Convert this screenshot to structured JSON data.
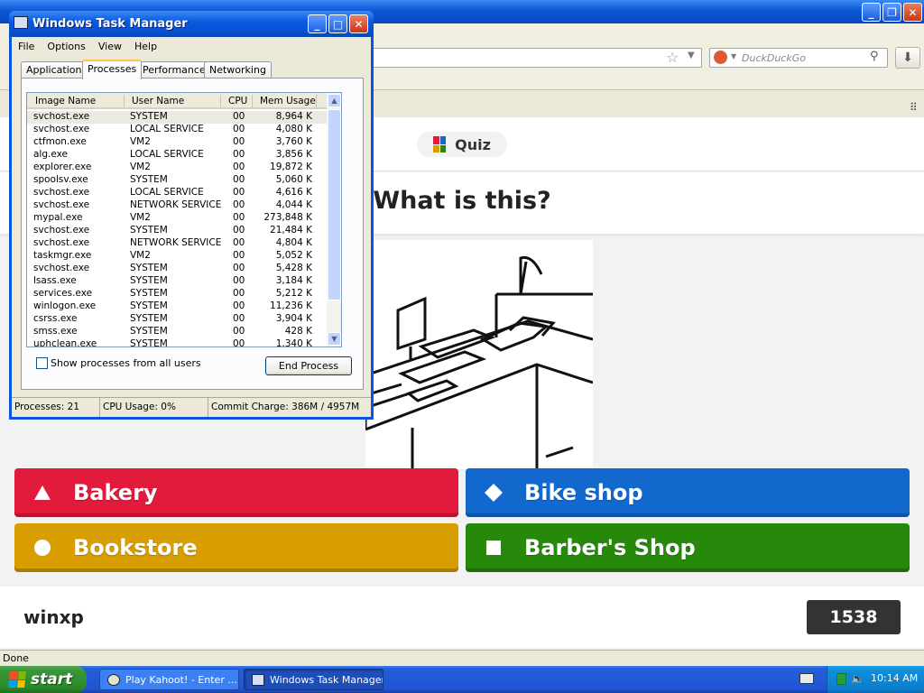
{
  "browser": {
    "search_placeholder": "DuckDuckGo"
  },
  "quiz": {
    "pill_label": "Quiz",
    "question": "What is this?",
    "answers": [
      {
        "label": "Bakery",
        "shape": "triangle",
        "color": "#e21b3c"
      },
      {
        "label": "Bike shop",
        "shape": "diamond",
        "color": "#1368ce"
      },
      {
        "label": "Bookstore",
        "shape": "circle",
        "color": "#d89e00"
      },
      {
        "label": "Barber's Shop",
        "shape": "square",
        "color": "#26890c"
      }
    ],
    "player_name": "winxp",
    "score": "1538"
  },
  "status_bar": "Done",
  "taskmgr": {
    "title": "Windows Task Manager",
    "menu": [
      "File",
      "Options",
      "View",
      "Help"
    ],
    "tabs": [
      "Applications",
      "Processes",
      "Performance",
      "Networking"
    ],
    "active_tab": "Processes",
    "columns": [
      "Image Name",
      "User Name",
      "CPU",
      "Mem Usage"
    ],
    "processes": [
      {
        "name": "svchost.exe",
        "user": "SYSTEM",
        "cpu": "00",
        "mem": "8,964 K"
      },
      {
        "name": "svchost.exe",
        "user": "LOCAL SERVICE",
        "cpu": "00",
        "mem": "4,080 K"
      },
      {
        "name": "ctfmon.exe",
        "user": "VM2",
        "cpu": "00",
        "mem": "3,760 K"
      },
      {
        "name": "alg.exe",
        "user": "LOCAL SERVICE",
        "cpu": "00",
        "mem": "3,856 K"
      },
      {
        "name": "explorer.exe",
        "user": "VM2",
        "cpu": "00",
        "mem": "19,872 K"
      },
      {
        "name": "spoolsv.exe",
        "user": "SYSTEM",
        "cpu": "00",
        "mem": "5,060 K"
      },
      {
        "name": "svchost.exe",
        "user": "LOCAL SERVICE",
        "cpu": "00",
        "mem": "4,616 K"
      },
      {
        "name": "svchost.exe",
        "user": "NETWORK SERVICE",
        "cpu": "00",
        "mem": "4,044 K"
      },
      {
        "name": "mypal.exe",
        "user": "VM2",
        "cpu": "00",
        "mem": "273,848 K"
      },
      {
        "name": "svchost.exe",
        "user": "SYSTEM",
        "cpu": "00",
        "mem": "21,484 K"
      },
      {
        "name": "svchost.exe",
        "user": "NETWORK SERVICE",
        "cpu": "00",
        "mem": "4,804 K"
      },
      {
        "name": "taskmgr.exe",
        "user": "VM2",
        "cpu": "00",
        "mem": "5,052 K"
      },
      {
        "name": "svchost.exe",
        "user": "SYSTEM",
        "cpu": "00",
        "mem": "5,428 K"
      },
      {
        "name": "lsass.exe",
        "user": "SYSTEM",
        "cpu": "00",
        "mem": "3,184 K"
      },
      {
        "name": "services.exe",
        "user": "SYSTEM",
        "cpu": "00",
        "mem": "5,212 K"
      },
      {
        "name": "winlogon.exe",
        "user": "SYSTEM",
        "cpu": "00",
        "mem": "11,236 K"
      },
      {
        "name": "csrss.exe",
        "user": "SYSTEM",
        "cpu": "00",
        "mem": "3,904 K"
      },
      {
        "name": "smss.exe",
        "user": "SYSTEM",
        "cpu": "00",
        "mem": "428 K"
      },
      {
        "name": "uphclean.exe",
        "user": "SYSTEM",
        "cpu": "00",
        "mem": "1,340 K"
      }
    ],
    "show_all_label": "Show processes from all users",
    "end_process_label": "End Process",
    "status": {
      "processes": "Processes: 21",
      "cpu": "CPU Usage: 0%",
      "commit": "Commit Charge: 386M / 4957M"
    }
  },
  "taskbar": {
    "start_label": "start",
    "tasks": [
      {
        "label": "Play Kahoot! - Enter ...",
        "icon": "browser-icon"
      },
      {
        "label": "Windows Task Manager",
        "icon": "taskmgr-icon"
      }
    ],
    "clock": "10:14 AM"
  }
}
